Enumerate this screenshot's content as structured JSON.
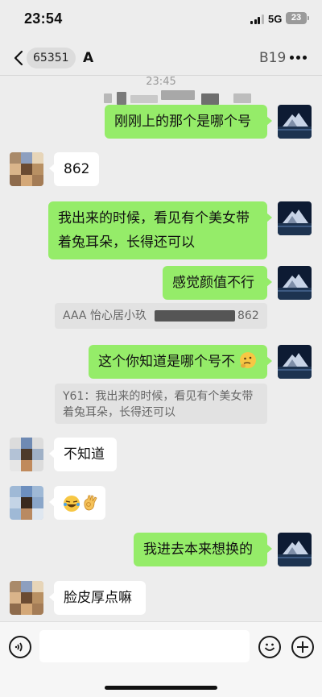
{
  "status_bar": {
    "time": "23:54",
    "network": "5G",
    "battery": "23"
  },
  "nav": {
    "unread_count": "65351",
    "title_prefix": "A",
    "title_suffix": "B19"
  },
  "chat": {
    "timestamp": "23:45",
    "messages": [
      {
        "side": "out",
        "text": "刚刚上的那个是哪个号"
      },
      {
        "side": "in",
        "text": "862"
      },
      {
        "side": "out",
        "text": "我出来的时候，看见有个美女带着兔耳朵，长得还可以"
      },
      {
        "side": "out",
        "text": "感觉颜值不行"
      },
      {
        "side": "quote",
        "prefix": "AAA 怡心居小玖",
        "suffix": "862"
      },
      {
        "side": "out",
        "text": "这个你知道是哪个号不"
      },
      {
        "side": "quote",
        "text": "Y61：我出来的时候，看见有个美女带着兔耳朵，长得还可以"
      },
      {
        "side": "in",
        "text": "不知道"
      },
      {
        "side": "in",
        "text": ""
      },
      {
        "side": "out",
        "text": "我进去本来想换的"
      },
      {
        "side": "in",
        "text": "脸皮厚点嘛"
      }
    ]
  },
  "icons": {
    "back": "chevron-left-icon",
    "more": "more-dots-icon",
    "voice": "voice-icon",
    "emoji": "smiley-icon",
    "plus": "plus-icon"
  },
  "colors": {
    "outgoing_bubble": "#95ec69",
    "incoming_bubble": "#ffffff",
    "background": "#ededed"
  }
}
